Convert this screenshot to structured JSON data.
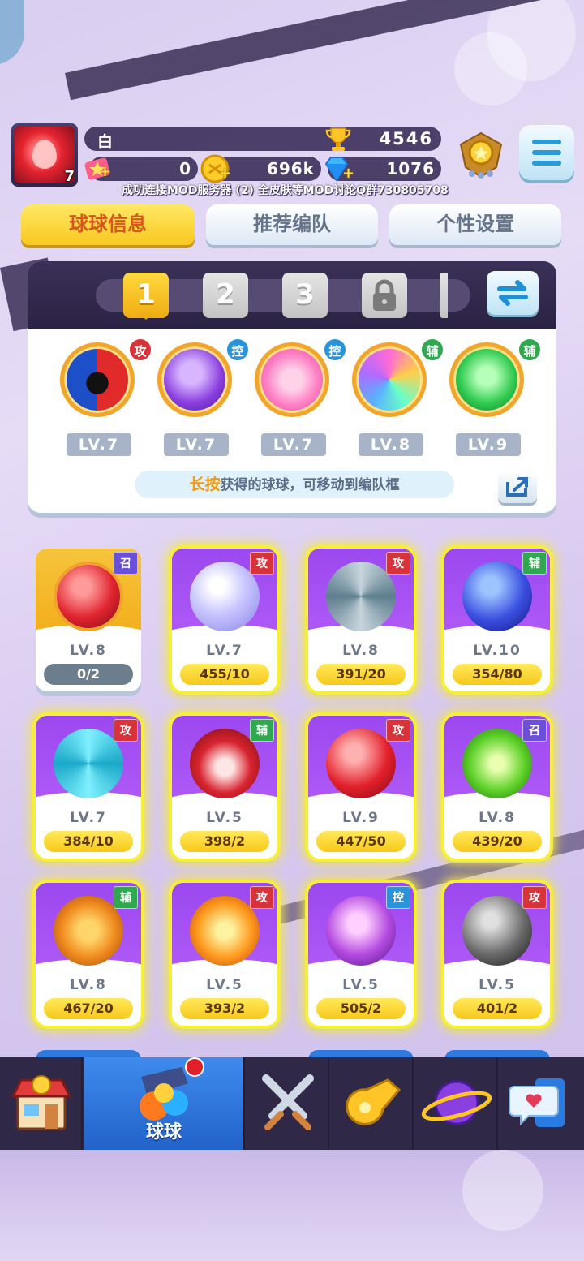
{
  "player": {
    "level": "7",
    "name": "白",
    "trophies": "4546",
    "stars": "0",
    "coins": "696k",
    "gems": "1076",
    "marquee": "成功连接MOD服务器 (2) 全皮肤等MOD讨论Q群730805708"
  },
  "tabs": [
    {
      "label": "球球信息"
    },
    {
      "label": "推荐编队"
    },
    {
      "label": "个性设置"
    }
  ],
  "team_slots": [
    "1",
    "2",
    "3"
  ],
  "team": [
    {
      "role": "攻",
      "lv": "LV.7",
      "color": "#d8323a",
      "ball": "opera-mask-ball"
    },
    {
      "role": "控",
      "lv": "LV.7",
      "color": "#2b93d9",
      "ball": "butterfly-ball"
    },
    {
      "role": "控",
      "lv": "LV.7",
      "color": "#2b93d9",
      "ball": "heart-ball"
    },
    {
      "role": "辅",
      "lv": "LV.8",
      "color": "#2fa84f",
      "ball": "crowd-ball"
    },
    {
      "role": "辅",
      "lv": "LV.9",
      "color": "#2fa84f",
      "ball": "star-arrow-ball"
    }
  ],
  "hint": {
    "highlight": "长按",
    "text": "获得的球球，可移动到编队框"
  },
  "cards": [
    {
      "role": "召",
      "lv": "LV.8",
      "prog": "0/2",
      "ball": "cannon-ball"
    },
    {
      "role": "攻",
      "lv": "LV.7",
      "prog": "455/10",
      "ball": "bubble-ball"
    },
    {
      "role": "攻",
      "lv": "LV.8",
      "prog": "391/20",
      "ball": "wind-ball"
    },
    {
      "role": "辅",
      "lv": "LV.10",
      "prog": "354/80",
      "ball": "swap-ball"
    },
    {
      "role": "攻",
      "lv": "LV.7",
      "prog": "384/10",
      "ball": "whirlpool-ball"
    },
    {
      "role": "辅",
      "lv": "LV.5",
      "prog": "398/2",
      "ball": "fang-ball"
    },
    {
      "role": "攻",
      "lv": "LV.9",
      "prog": "447/50",
      "ball": "lightning-ball"
    },
    {
      "role": "召",
      "lv": "LV.8",
      "prog": "439/20",
      "ball": "radiation-ball"
    },
    {
      "role": "辅",
      "lv": "LV.8",
      "prog": "467/20",
      "ball": "pumpkin-ball"
    },
    {
      "role": "攻",
      "lv": "LV.5",
      "prog": "393/2",
      "ball": "sun-ball"
    },
    {
      "role": "控",
      "lv": "LV.5",
      "prog": "505/2",
      "ball": "cloud-ball"
    },
    {
      "role": "攻",
      "lv": "LV.5",
      "prog": "401/2",
      "ball": "scythe-ball"
    }
  ],
  "nav": [
    {
      "name": "shop-icon",
      "label": ""
    },
    {
      "name": "balls-icon",
      "label": "球球"
    },
    {
      "name": "battle-swords-icon",
      "label": ""
    },
    {
      "name": "whistle-icon",
      "label": ""
    },
    {
      "name": "planet-icon",
      "label": ""
    },
    {
      "name": "chat-heart-icon",
      "label": ""
    }
  ],
  "colors": {
    "attack": "#d8323a",
    "control": "#2b93d9",
    "support": "#2fa84f",
    "summon": "#6b4fd8",
    "accent": "#f8c81f"
  }
}
